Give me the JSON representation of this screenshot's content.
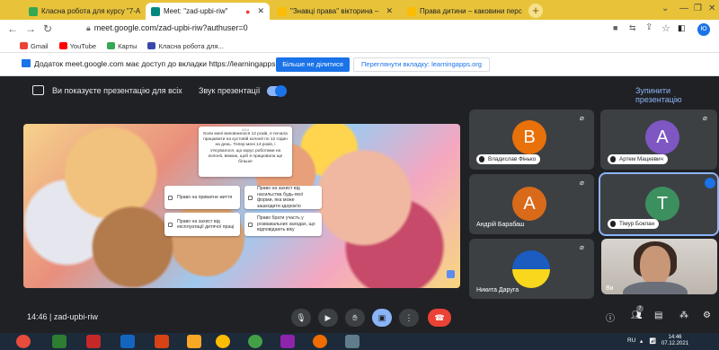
{
  "browser": {
    "tabs": [
      {
        "title": "Класна робота для курсу \"7-А \"",
        "active": false
      },
      {
        "title": "Meet: \"zad-upbi-riw\"",
        "active": true
      },
      {
        "title": "\"Знавці права\" вікторина – ",
        "active": false
      },
      {
        "title": "Права дитини – каковини перс",
        "active": false
      }
    ],
    "url": "meet.google.com/zad-upbi-riw?authuser=0",
    "profile_initial": "Ю"
  },
  "bookmarks": [
    {
      "label": "Gmail",
      "color": "#ea4335"
    },
    {
      "label": "YouTube",
      "color": "#ff0000"
    },
    {
      "label": "Карты",
      "color": "#34a853"
    },
    {
      "label": "Класна робота для...",
      "color": "#3949ab"
    }
  ],
  "sharebar": {
    "text": "Додаток meet.google.com має доступ до вкладки https://learningapps.org",
    "stop_label": "Більше не ділитися",
    "switch_label": "Переглянути вкладку: learningapps.org"
  },
  "meet_top": {
    "present_label": "Ви показуєте презентацію для всіх",
    "audio_label": "Звук презентації",
    "stop_label": "Зупинити презентацію"
  },
  "slide": {
    "page": "4/14",
    "question": "Коли мені виповнилося 12 років, я почала працювати на кустовій колонії по 12 годин на день. Тепер мені 14 років, і з'ясувалося, що корус роботами на колонії, ввжаю, щоб я працювала ще більше",
    "answers": [
      "Право на приватне життя",
      "Право на захист від експлуатації дитячої праці",
      "Право на захист від насильства будь-якої форми, яка може зашкодити здоров'ю",
      "Право брати участь у розважальних заходах, що відповідають віку"
    ]
  },
  "participants": [
    {
      "name": "Владислав Фінько",
      "initial": "B",
      "color": "#e8710a"
    },
    {
      "name": "Артем Мацкевич",
      "initial": "A",
      "color": "#7e57c2"
    },
    {
      "name": "Андрій Барабаш",
      "initial": "A",
      "color": "#d96a1a"
    },
    {
      "name": "Тімур Боклан",
      "initial": "T",
      "color": "#3c8f5e"
    },
    {
      "name": "Никита Даруга",
      "initial": ""
    },
    {
      "name": "Ви",
      "initial": ""
    }
  ],
  "bottom": {
    "time": "14:46",
    "meeting_code": "zad-upbi-riw",
    "participants_badge": "7"
  },
  "taskbar": {
    "lang": "RU",
    "time": "14:46",
    "date": "07.12.2021"
  }
}
